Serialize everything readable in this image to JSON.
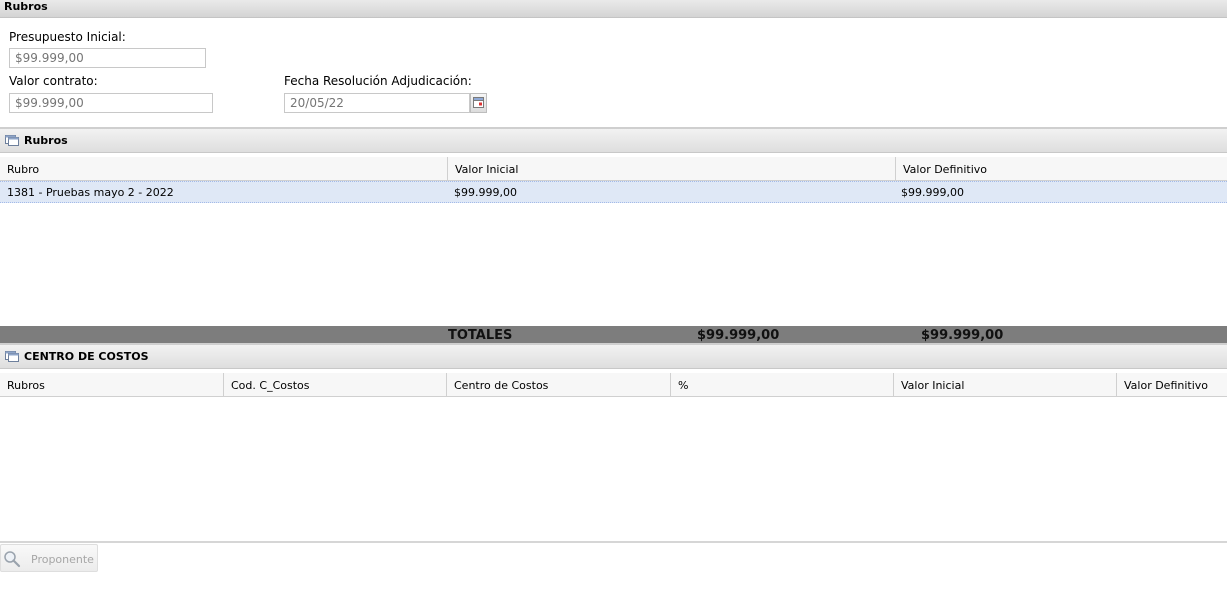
{
  "window": {
    "title": "Rubros"
  },
  "form": {
    "presupuesto_label": "Presupuesto Inicial:",
    "presupuesto_placeholder": "$99.999,00",
    "valor_contrato_label": "Valor contrato:",
    "valor_contrato_placeholder": "$99.999,00",
    "fecha_label": "Fecha Resolución Adjudicación:",
    "fecha_placeholder": "20/05/22"
  },
  "icons": {
    "panel": "window-icon",
    "calendar": "calendar-icon",
    "search": "search-icon"
  },
  "rubros_panel": {
    "title": "Rubros",
    "columns": [
      "Rubro",
      "Valor Inicial",
      "Valor Definitivo"
    ],
    "rows": [
      {
        "rubro": "1381 - Pruebas mayo 2 - 2022",
        "valor_inicial": "$99.999,00",
        "valor_definitivo": "$99.999,00"
      }
    ]
  },
  "totals": {
    "label": "TOTALES",
    "valor_inicial": "$99.999,00",
    "valor_definitivo": "$99.999,00"
  },
  "costos_panel": {
    "title": "CENTRO DE COSTOS",
    "columns": [
      "Rubros",
      "Cod. C_Costos",
      "Centro de Costos",
      "%",
      "Valor Inicial",
      "Valor Definitivo"
    ]
  },
  "footer": {
    "proponente_label": "Proponente"
  },
  "colors": {
    "selected_row": "#dfe8f6",
    "totals_bar": "#7d7d7d",
    "muted_text": "#9a9a9a"
  }
}
